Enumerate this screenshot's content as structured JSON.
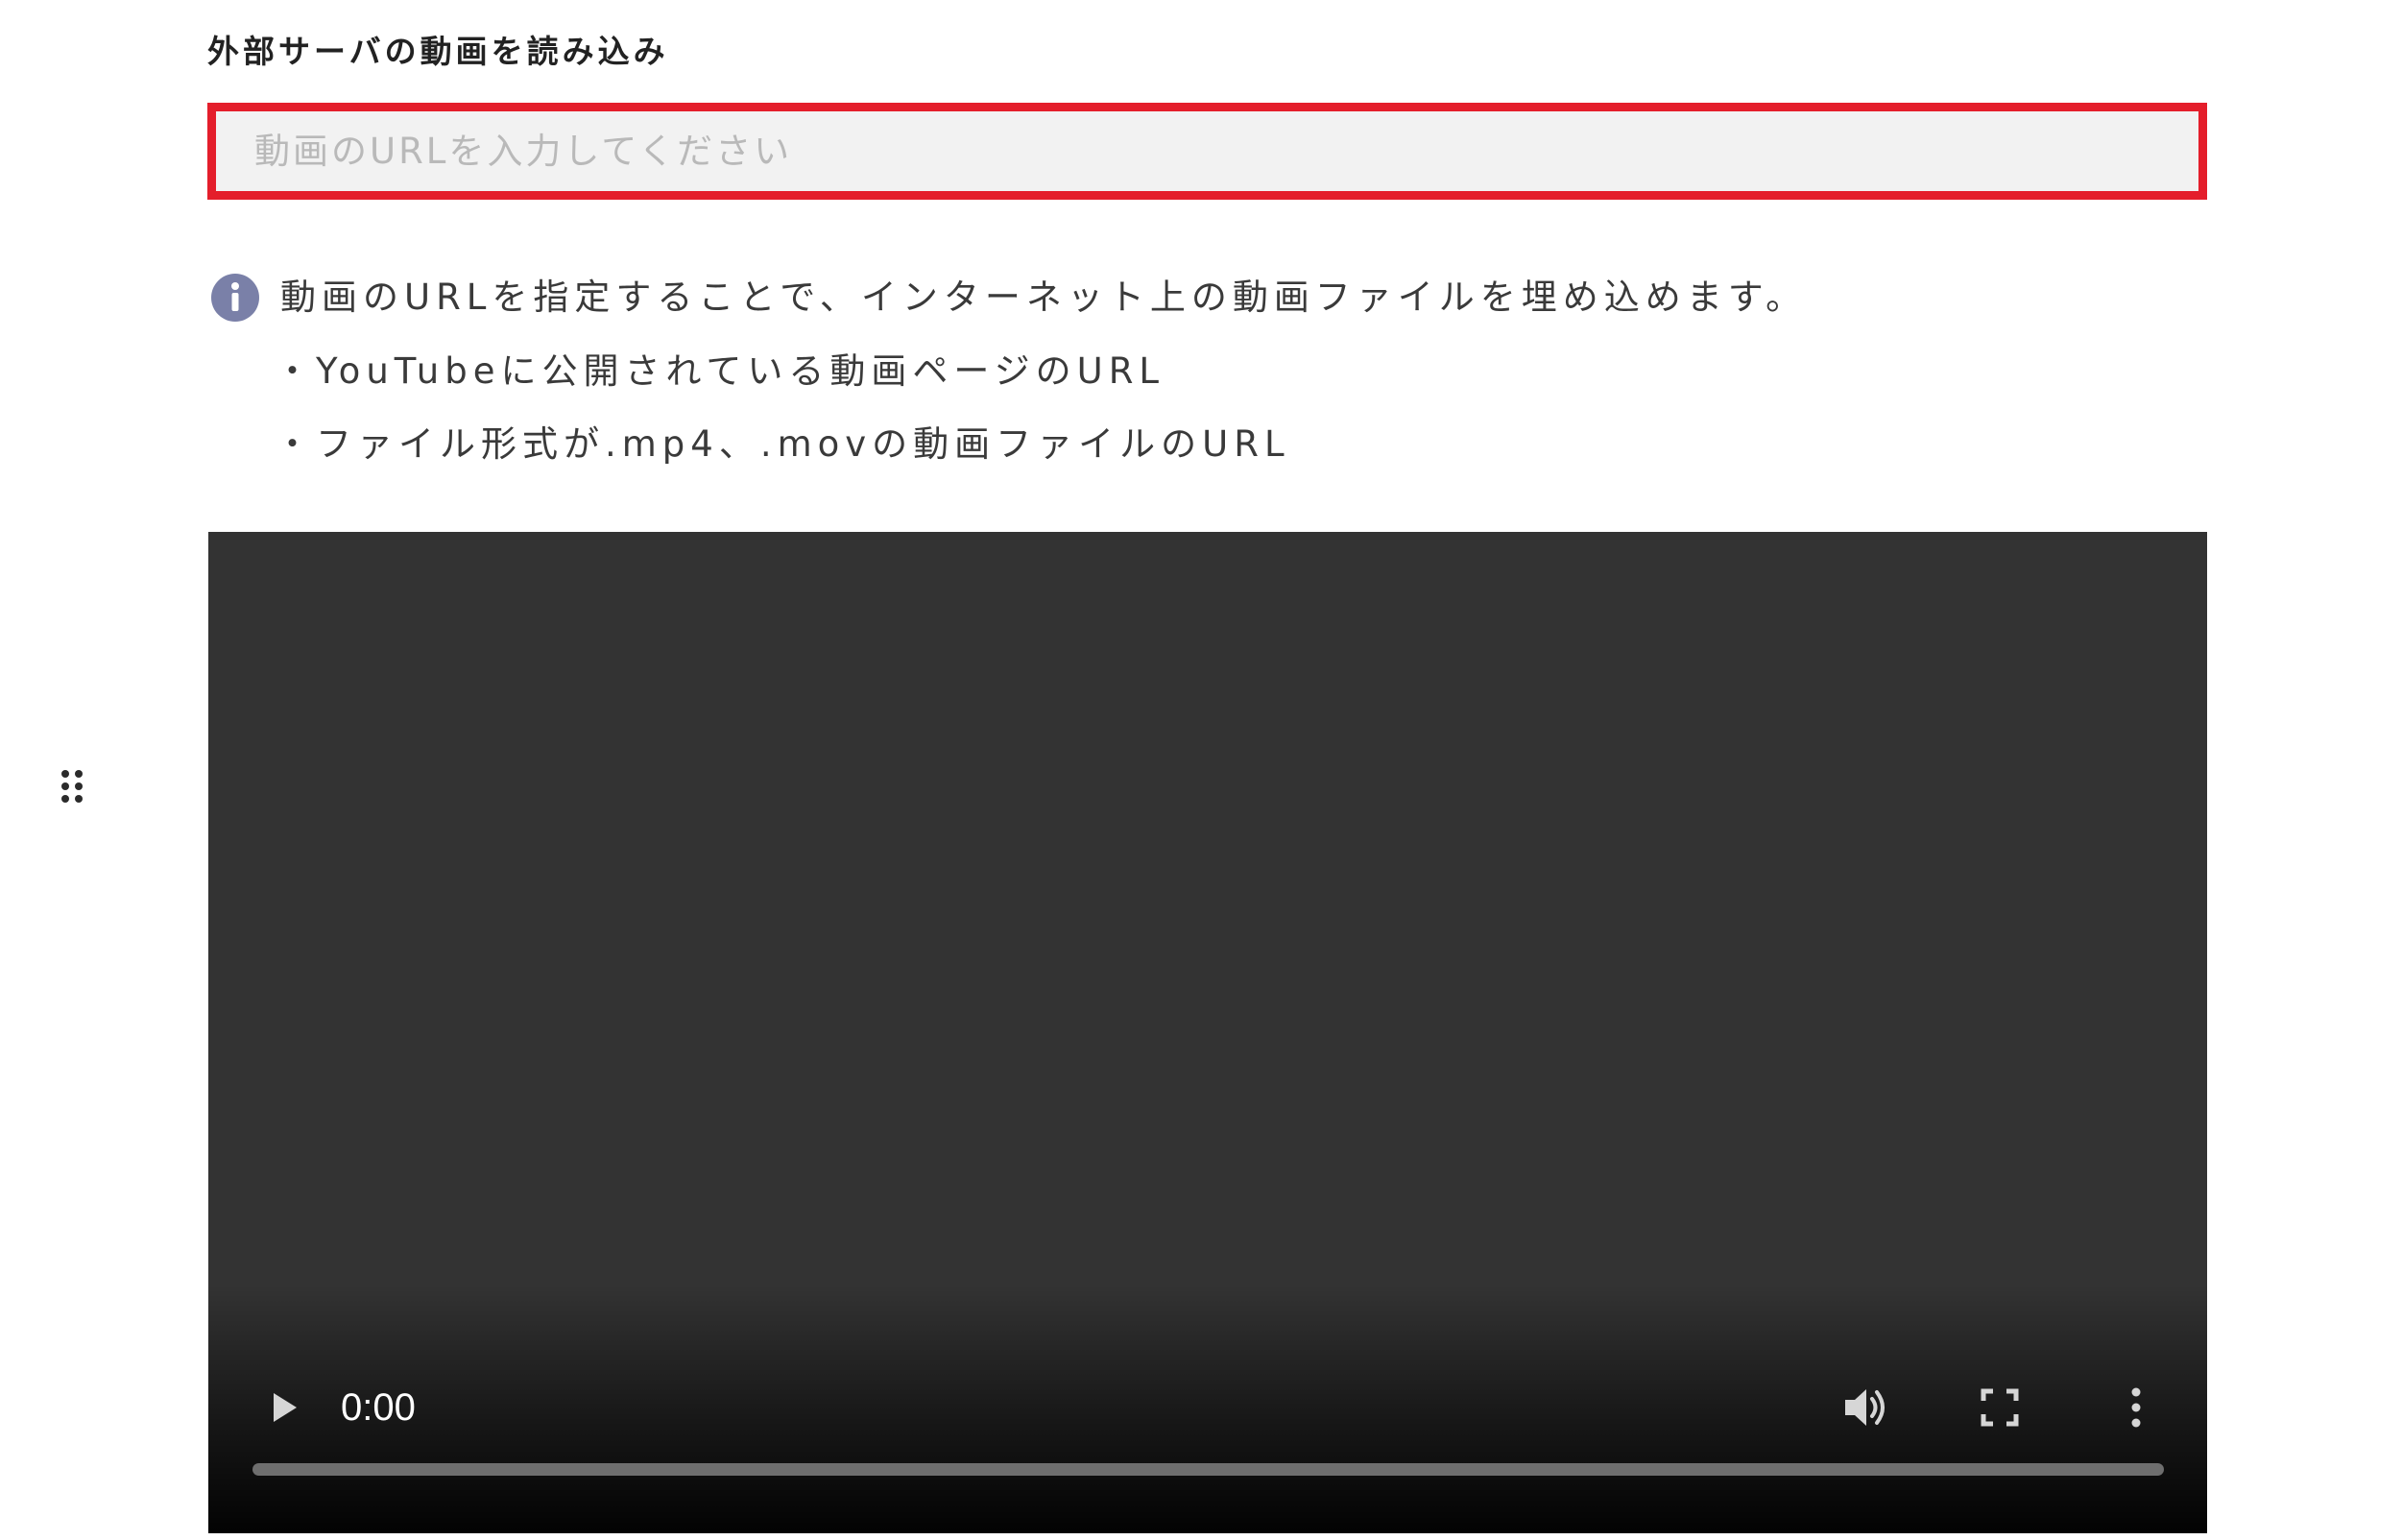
{
  "section": {
    "title": "外部サーバの動画を読み込み"
  },
  "url_input": {
    "placeholder": "動画のURLを入力してください",
    "value": ""
  },
  "info": {
    "text": "動画のURLを指定することで、インターネット上の動画ファイルを埋め込めます。",
    "bullets": [
      "・YouTubeに公開されている動画ページのURL",
      "・ファイル形式が.mp4、.movの動画ファイルのURL"
    ]
  },
  "video": {
    "time": "0:00",
    "progress": 0
  },
  "colors": {
    "highlight": "#e41e2b",
    "info_icon": "#7a80a8",
    "video_bg": "#333333"
  },
  "icons": {
    "info": "info-icon",
    "drag": "drag-handle-icon",
    "play": "play-icon",
    "volume": "volume-icon",
    "fullscreen": "fullscreen-icon",
    "menu": "more-vertical-icon"
  }
}
